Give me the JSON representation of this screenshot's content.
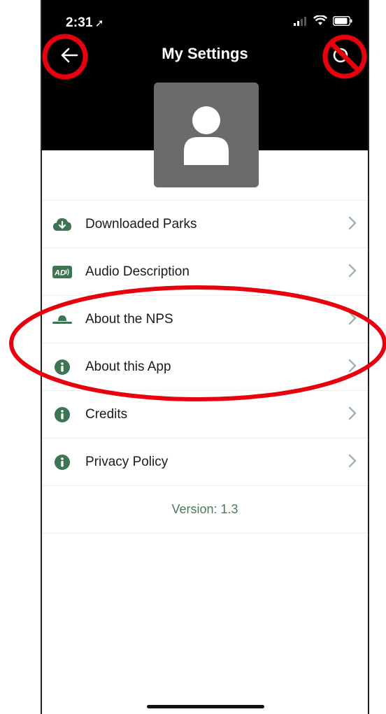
{
  "status_bar": {
    "time": "2:31",
    "location_glyph": "➚"
  },
  "header": {
    "title": "My Settings"
  },
  "icons": {
    "back": "arrow-left-icon",
    "right_action": "circle-icon",
    "avatar": "user-icon"
  },
  "menu": {
    "items": [
      {
        "label": "Downloaded Parks",
        "icon": "cloud-download-icon"
      },
      {
        "label": "Audio Description",
        "icon": "audio-description-icon"
      },
      {
        "label": "About the NPS",
        "icon": "ranger-hat-icon"
      },
      {
        "label": "About this App",
        "icon": "info-icon"
      },
      {
        "label": "Credits",
        "icon": "info-icon"
      },
      {
        "label": "Privacy Policy",
        "icon": "info-icon"
      }
    ]
  },
  "footer": {
    "version": "Version: 1.3"
  },
  "colors": {
    "accent_green": "#4b7a5a",
    "header_bg": "#000000",
    "annotation_red": "#e8000f"
  }
}
